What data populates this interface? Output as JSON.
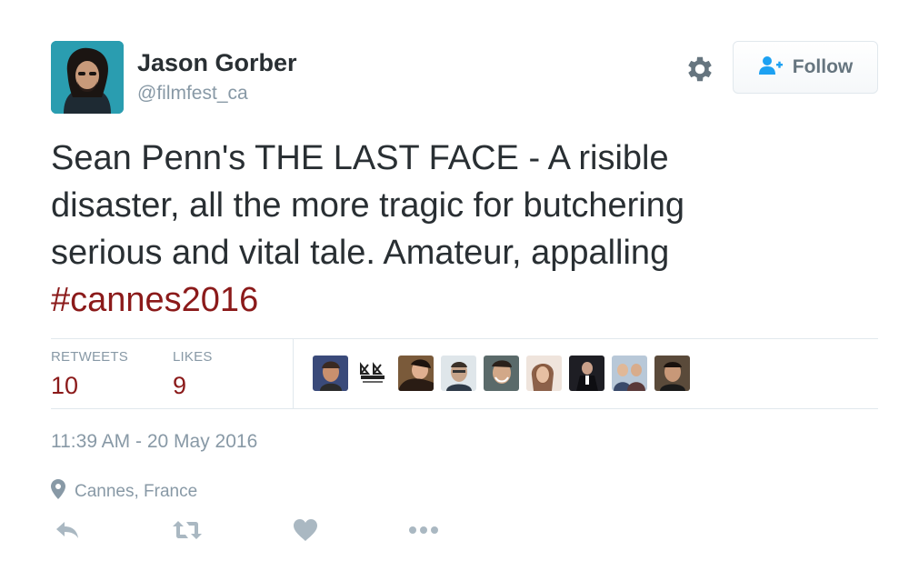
{
  "author": {
    "name": "Jason Gorber",
    "handle": "@filmfest_ca",
    "avatar_icon": "user-avatar"
  },
  "header": {
    "settings_icon": "gear-icon",
    "follow_label": "Follow",
    "follow_icon": "add-user-icon"
  },
  "tweet": {
    "lines": [
      "Sean Penn's THE LAST FACE - A risible",
      "disaster, all the more tragic for butchering",
      "serious and vital tale. Amateur, appalling"
    ],
    "hashtag": "#cannes2016"
  },
  "stats": {
    "retweets_label": "RETWEETS",
    "retweets_count": "10",
    "likes_label": "LIKES",
    "likes_count": "9"
  },
  "likers_count_shown": 9,
  "timestamp": "11:39 AM - 20 May 2016",
  "location": "Cannes, France",
  "actions": [
    "reply-icon",
    "retweet-icon",
    "like-icon",
    "more-icon"
  ],
  "colors": {
    "accent": "#8b1a1a",
    "muted": "#8899a6",
    "text": "#292f33",
    "border": "#e1e8ed"
  }
}
